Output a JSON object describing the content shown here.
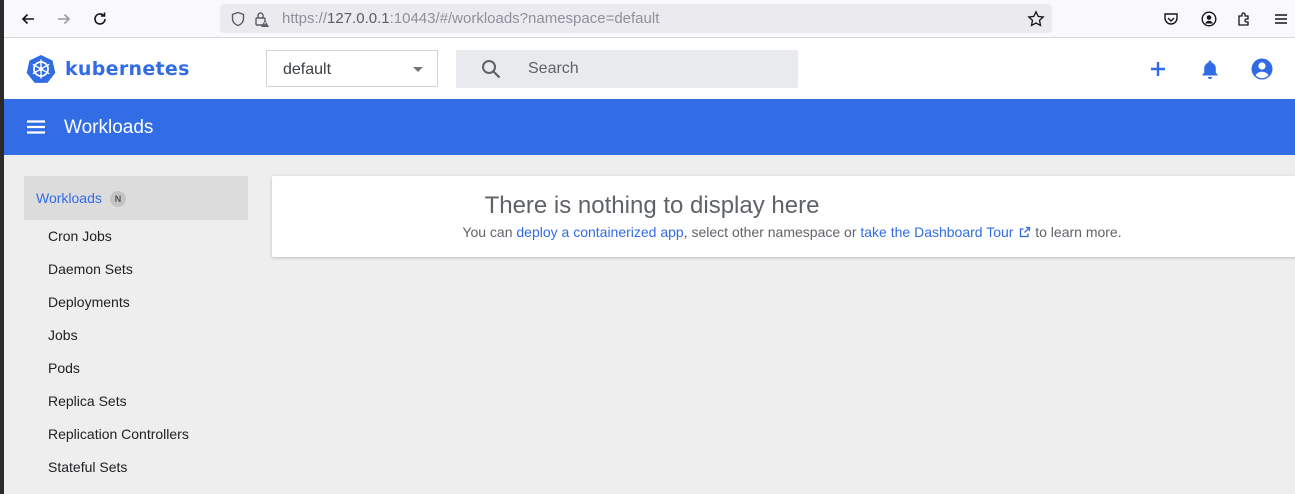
{
  "browser": {
    "url_prefix": "https://",
    "url_host": "127.0.0.1",
    "url_rest": ":10443/#/workloads?namespace=default"
  },
  "app": {
    "logo_text": "kubernetes",
    "namespace": {
      "value": "default"
    },
    "search": {
      "placeholder": "Search"
    }
  },
  "toolbar": {
    "title": "Workloads"
  },
  "sidebar": {
    "header": {
      "label": "Workloads",
      "badge": "N"
    },
    "items": [
      {
        "label": "Cron Jobs"
      },
      {
        "label": "Daemon Sets"
      },
      {
        "label": "Deployments"
      },
      {
        "label": "Jobs"
      },
      {
        "label": "Pods"
      },
      {
        "label": "Replica Sets"
      },
      {
        "label": "Replication Controllers"
      },
      {
        "label": "Stateful Sets"
      }
    ]
  },
  "empty_state": {
    "title": "There is nothing to display here",
    "text_before": "You can ",
    "link_deploy": "deploy a containerized app",
    "text_middle": ", select other namespace or ",
    "link_tour": "take the Dashboard Tour",
    "text_after": " to learn more."
  },
  "colors": {
    "accent": "#326ce5",
    "toolbar": "#326de6",
    "background": "#eeeeee"
  }
}
